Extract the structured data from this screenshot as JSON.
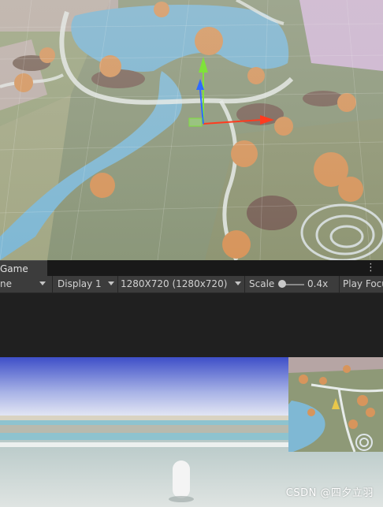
{
  "game_panel": {
    "tab_label": "Game",
    "more_menu_icon": "kebab-menu-icon",
    "toolbar": {
      "mode_label": "ne",
      "display_label": "Display 1",
      "resolution_label": "1280X720 (1280x720)",
      "scale_label": "Scale",
      "scale_value": "0.4x",
      "play_focus_label": "Play Focu"
    }
  },
  "scene_gizmo": {
    "icons": [
      "move-y-arrow-icon",
      "move-x-arrow-icon",
      "move-z-arrow-icon",
      "plane-handle-icon"
    ],
    "colors": {
      "x": "#ff3b1f",
      "y": "#7fe23a",
      "z": "#2f6bff"
    }
  },
  "watermark": "CSDN @四夕立羽"
}
